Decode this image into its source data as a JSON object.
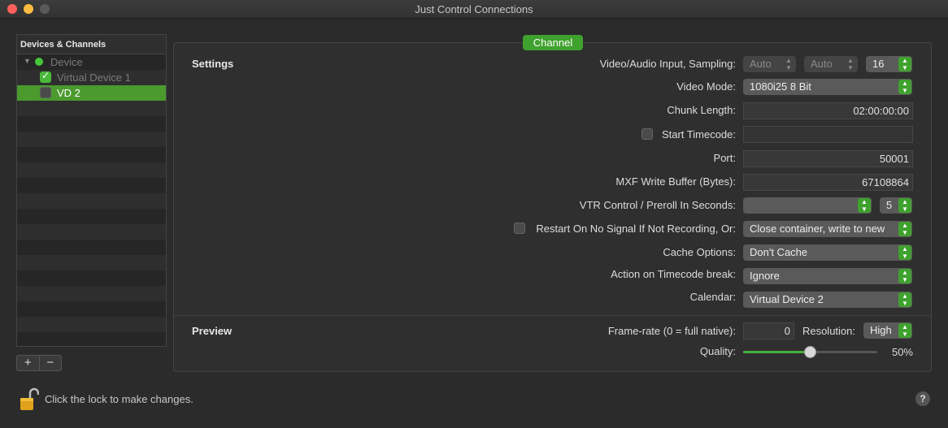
{
  "window": {
    "title": "Just Control Connections"
  },
  "sidebar": {
    "header": "Devices & Channels",
    "device_label": "Device",
    "items": [
      {
        "label": "Virtual Device 1",
        "checked": true
      },
      {
        "label": "VD 2",
        "checked": false
      }
    ],
    "add_label": "+",
    "remove_label": "−"
  },
  "tab": {
    "label": "Channel"
  },
  "settings": {
    "section_label": "Settings",
    "video_audio": {
      "label": "Video/Audio Input, Sampling:",
      "input1": "Auto",
      "input2": "Auto",
      "sampling": "16"
    },
    "video_mode": {
      "label": "Video Mode:",
      "value": "1080i25 8 Bit"
    },
    "chunk_length": {
      "label": "Chunk Length:",
      "value": "02:00:00:00"
    },
    "start_timecode": {
      "label": "Start Timecode:",
      "value": ""
    },
    "port": {
      "label": "Port:",
      "value": "50001"
    },
    "mxf_buffer": {
      "label": "MXF Write Buffer (Bytes):",
      "value": "67108864"
    },
    "vtr_control": {
      "label": "VTR Control / Preroll In Seconds:",
      "value": "",
      "preroll": "5"
    },
    "restart": {
      "label": "Restart On No Signal If Not Recording, Or:",
      "value": "Close container, write to new"
    },
    "cache": {
      "label": "Cache Options:",
      "value": "Don't Cache"
    },
    "timecode_break": {
      "label": "Action on Timecode break:",
      "value": "Ignore"
    },
    "calendar": {
      "label": "Calendar:",
      "value": "Virtual Device 2"
    }
  },
  "preview": {
    "section_label": "Preview",
    "framerate": {
      "label": "Frame-rate (0 = full native):",
      "value": "0"
    },
    "resolution": {
      "label": "Resolution:",
      "value": "High"
    },
    "quality": {
      "label": "Quality:",
      "value": "50%",
      "fraction": 0.5
    }
  },
  "footer": {
    "lock_text": "Click the lock to make changes.",
    "help_label": "?"
  }
}
